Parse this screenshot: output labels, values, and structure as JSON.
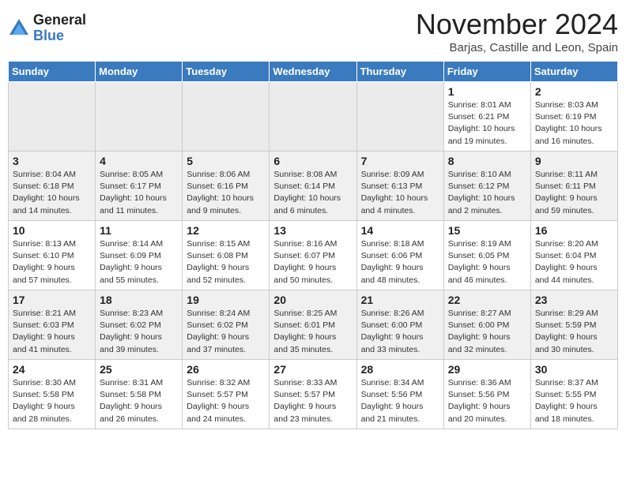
{
  "header": {
    "logo_line1": "General",
    "logo_line2": "Blue",
    "month": "November 2024",
    "location": "Barjas, Castille and Leon, Spain"
  },
  "days_of_week": [
    "Sunday",
    "Monday",
    "Tuesday",
    "Wednesday",
    "Thursday",
    "Friday",
    "Saturday"
  ],
  "weeks": [
    [
      {
        "day": null
      },
      {
        "day": null
      },
      {
        "day": null
      },
      {
        "day": null
      },
      {
        "day": null
      },
      {
        "day": 1,
        "sunrise": "8:01 AM",
        "sunset": "6:21 PM",
        "daylight": "10 hours and 19 minutes."
      },
      {
        "day": 2,
        "sunrise": "8:03 AM",
        "sunset": "6:19 PM",
        "daylight": "10 hours and 16 minutes."
      }
    ],
    [
      {
        "day": 3,
        "sunrise": "8:04 AM",
        "sunset": "6:18 PM",
        "daylight": "10 hours and 14 minutes."
      },
      {
        "day": 4,
        "sunrise": "8:05 AM",
        "sunset": "6:17 PM",
        "daylight": "10 hours and 11 minutes."
      },
      {
        "day": 5,
        "sunrise": "8:06 AM",
        "sunset": "6:16 PM",
        "daylight": "10 hours and 9 minutes."
      },
      {
        "day": 6,
        "sunrise": "8:08 AM",
        "sunset": "6:14 PM",
        "daylight": "10 hours and 6 minutes."
      },
      {
        "day": 7,
        "sunrise": "8:09 AM",
        "sunset": "6:13 PM",
        "daylight": "10 hours and 4 minutes."
      },
      {
        "day": 8,
        "sunrise": "8:10 AM",
        "sunset": "6:12 PM",
        "daylight": "10 hours and 2 minutes."
      },
      {
        "day": 9,
        "sunrise": "8:11 AM",
        "sunset": "6:11 PM",
        "daylight": "9 hours and 59 minutes."
      }
    ],
    [
      {
        "day": 10,
        "sunrise": "8:13 AM",
        "sunset": "6:10 PM",
        "daylight": "9 hours and 57 minutes."
      },
      {
        "day": 11,
        "sunrise": "8:14 AM",
        "sunset": "6:09 PM",
        "daylight": "9 hours and 55 minutes."
      },
      {
        "day": 12,
        "sunrise": "8:15 AM",
        "sunset": "6:08 PM",
        "daylight": "9 hours and 52 minutes."
      },
      {
        "day": 13,
        "sunrise": "8:16 AM",
        "sunset": "6:07 PM",
        "daylight": "9 hours and 50 minutes."
      },
      {
        "day": 14,
        "sunrise": "8:18 AM",
        "sunset": "6:06 PM",
        "daylight": "9 hours and 48 minutes."
      },
      {
        "day": 15,
        "sunrise": "8:19 AM",
        "sunset": "6:05 PM",
        "daylight": "9 hours and 46 minutes."
      },
      {
        "day": 16,
        "sunrise": "8:20 AM",
        "sunset": "6:04 PM",
        "daylight": "9 hours and 44 minutes."
      }
    ],
    [
      {
        "day": 17,
        "sunrise": "8:21 AM",
        "sunset": "6:03 PM",
        "daylight": "9 hours and 41 minutes."
      },
      {
        "day": 18,
        "sunrise": "8:23 AM",
        "sunset": "6:02 PM",
        "daylight": "9 hours and 39 minutes."
      },
      {
        "day": 19,
        "sunrise": "8:24 AM",
        "sunset": "6:02 PM",
        "daylight": "9 hours and 37 minutes."
      },
      {
        "day": 20,
        "sunrise": "8:25 AM",
        "sunset": "6:01 PM",
        "daylight": "9 hours and 35 minutes."
      },
      {
        "day": 21,
        "sunrise": "8:26 AM",
        "sunset": "6:00 PM",
        "daylight": "9 hours and 33 minutes."
      },
      {
        "day": 22,
        "sunrise": "8:27 AM",
        "sunset": "6:00 PM",
        "daylight": "9 hours and 32 minutes."
      },
      {
        "day": 23,
        "sunrise": "8:29 AM",
        "sunset": "5:59 PM",
        "daylight": "9 hours and 30 minutes."
      }
    ],
    [
      {
        "day": 24,
        "sunrise": "8:30 AM",
        "sunset": "5:58 PM",
        "daylight": "9 hours and 28 minutes."
      },
      {
        "day": 25,
        "sunrise": "8:31 AM",
        "sunset": "5:58 PM",
        "daylight": "9 hours and 26 minutes."
      },
      {
        "day": 26,
        "sunrise": "8:32 AM",
        "sunset": "5:57 PM",
        "daylight": "9 hours and 24 minutes."
      },
      {
        "day": 27,
        "sunrise": "8:33 AM",
        "sunset": "5:57 PM",
        "daylight": "9 hours and 23 minutes."
      },
      {
        "day": 28,
        "sunrise": "8:34 AM",
        "sunset": "5:56 PM",
        "daylight": "9 hours and 21 minutes."
      },
      {
        "day": 29,
        "sunrise": "8:36 AM",
        "sunset": "5:56 PM",
        "daylight": "9 hours and 20 minutes."
      },
      {
        "day": 30,
        "sunrise": "8:37 AM",
        "sunset": "5:55 PM",
        "daylight": "9 hours and 18 minutes."
      }
    ]
  ],
  "labels": {
    "sunrise": "Sunrise:",
    "sunset": "Sunset:",
    "daylight": "Daylight:"
  }
}
